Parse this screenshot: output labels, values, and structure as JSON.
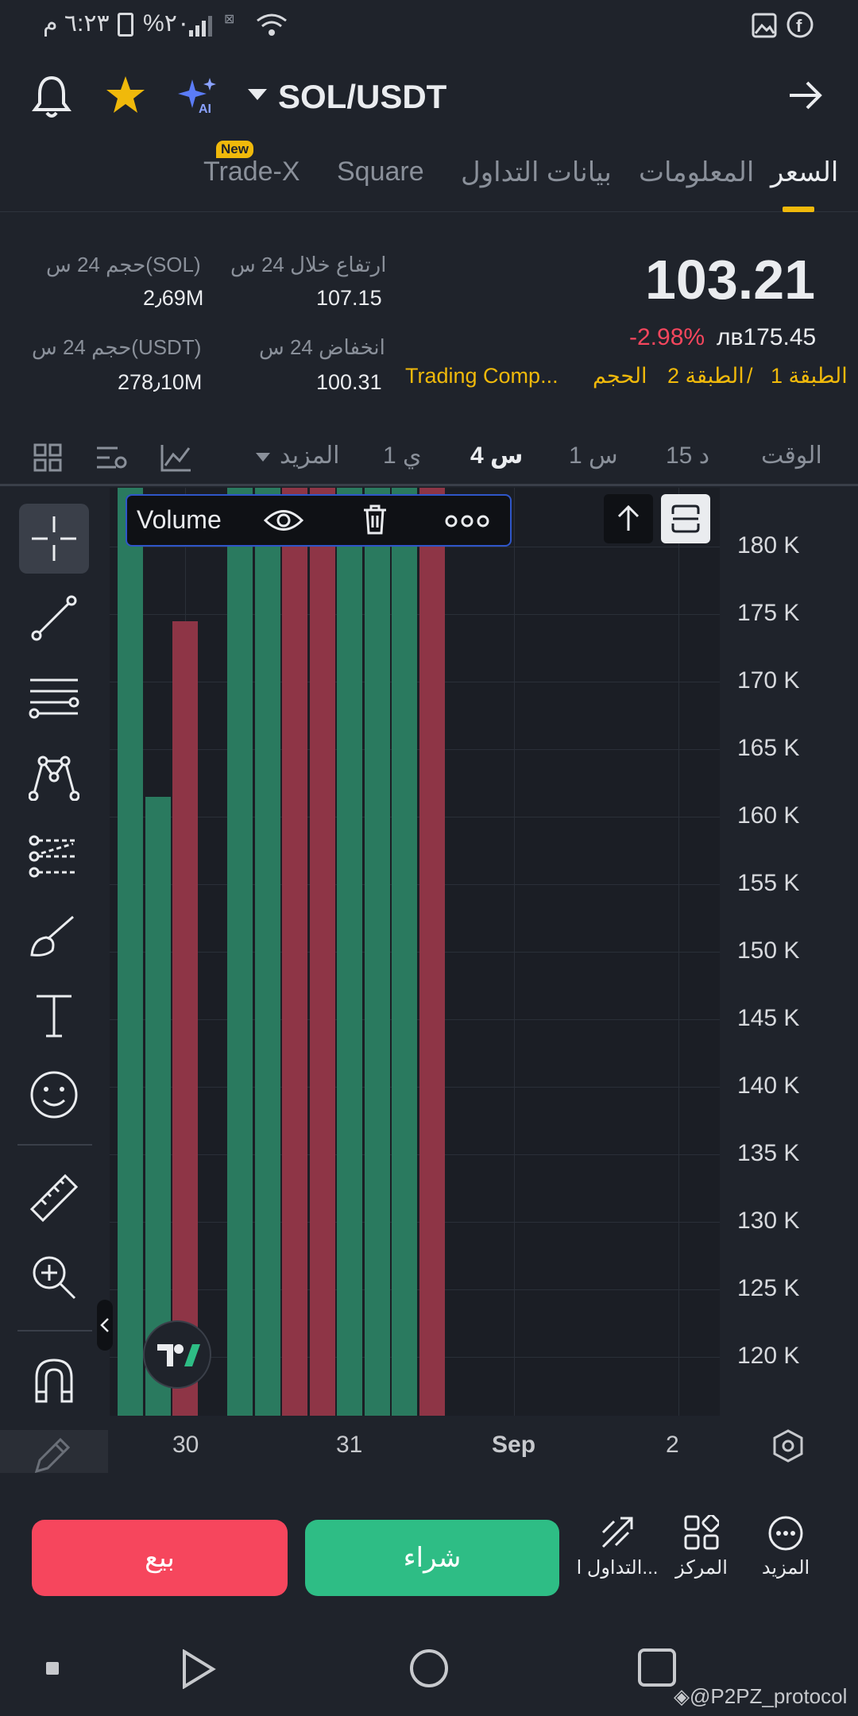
{
  "status_bar": {
    "time": "٦:٢٣ م",
    "battery": "%٢٠"
  },
  "header": {
    "pair": "SOL/USDT",
    "ai_label": "AI"
  },
  "tabs": [
    {
      "label": "السعر",
      "active": true
    },
    {
      "label": "المعلومات",
      "active": false
    },
    {
      "label": "بيانات التداول",
      "active": false
    },
    {
      "label": "Square",
      "active": false
    },
    {
      "label": "Trade-X",
      "active": false,
      "badge": "New"
    }
  ],
  "price": {
    "last": "103.21",
    "fiat": "лв175.45",
    "change": "-2.98%",
    "high_label": "ارتفاع خلال 24 س",
    "high_value": "107.15",
    "low_label": "انخفاض 24 س",
    "low_value": "100.31",
    "vol_sol_label": "حجم 24 س(SOL)",
    "vol_sol_value": "2٫69M",
    "vol_usdt_label": "حجم 24 س(USDT)",
    "vol_usdt_value": "278٫10M"
  },
  "tags": {
    "layer1": "الطبقة 1",
    "sep": "/",
    "layer2": "الطبقة 2",
    "volume": "الحجم",
    "trading": "Trading Comp..."
  },
  "timeframes": {
    "time_label": "الوقت",
    "items": [
      "15 د",
      "1 س",
      "4 س",
      "1 ي"
    ],
    "active": "4 س",
    "more": "المزيد"
  },
  "volume_legend": {
    "label": "Volume"
  },
  "chart_data": {
    "type": "bar",
    "title": "Volume",
    "y_ticks": [
      "180 K",
      "175 K",
      "170 K",
      "165 K",
      "160 K",
      "155 K",
      "150 K",
      "145 K",
      "140 K",
      "135 K",
      "130 K",
      "125 K",
      "120 K"
    ],
    "x_ticks": [
      "30",
      "31",
      "Sep",
      "2"
    ],
    "ylim": [
      115000,
      183500
    ],
    "series": [
      {
        "values": [
          190000,
          161500,
          174500,
          null,
          190000,
          190000,
          190000,
          190000,
          190000,
          190000,
          190000,
          190000
        ],
        "colors": [
          "up",
          "up",
          "down",
          "none",
          "up",
          "up",
          "down",
          "down",
          "up",
          "up",
          "up",
          "down"
        ]
      }
    ],
    "up_color": "#2a7a5f",
    "down_color": "#8e3546"
  },
  "bottom_bar": {
    "sell": "بيع",
    "buy": "شراء",
    "trading": "التداول ا...",
    "center": "المركز",
    "more": "المزيد"
  },
  "watermark": "@P2PZ_protocol",
  "colors": {
    "accent": "#f0b90b",
    "up": "#2ebd85",
    "down": "#f6465d"
  }
}
